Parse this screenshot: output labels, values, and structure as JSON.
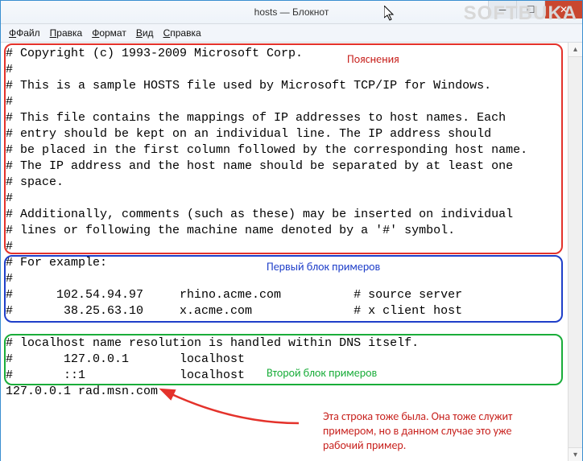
{
  "window": {
    "title": "hosts — Блокнот",
    "watermark": "SOFTBUKA"
  },
  "menu": {
    "file": "Файл",
    "edit": "Правка",
    "format": "Формат",
    "view": "Вид",
    "help": "Справка"
  },
  "file_lines": [
    "# Copyright (c) 1993-2009 Microsoft Corp.",
    "#",
    "# This is a sample HOSTS file used by Microsoft TCP/IP for Windows.",
    "#",
    "# This file contains the mappings of IP addresses to host names. Each",
    "# entry should be kept on an individual line. The IP address should",
    "# be placed in the first column followed by the corresponding host name.",
    "# The IP address and the host name should be separated by at least one",
    "# space.",
    "#",
    "# Additionally, comments (such as these) may be inserted on individual",
    "# lines or following the machine name denoted by a '#' symbol.",
    "#",
    "# For example:",
    "#",
    "#      102.54.94.97     rhino.acme.com          # source server",
    "#       38.25.63.10     x.acme.com              # x client host",
    "",
    "# localhost name resolution is handled within DNS itself.",
    "#       127.0.0.1       localhost",
    "#       ::1             localhost",
    "127.0.0.1 rad.msn.com"
  ],
  "annotations": {
    "block1_label": "Пояснения",
    "block2_label": "Первый блок примеров",
    "block3_label": "Второй блок примеров",
    "note_line1": "Эта строка тоже была. Она тоже служит",
    "note_line2": "примером, но в данном случае это уже",
    "note_line3": "рабочий пример."
  }
}
